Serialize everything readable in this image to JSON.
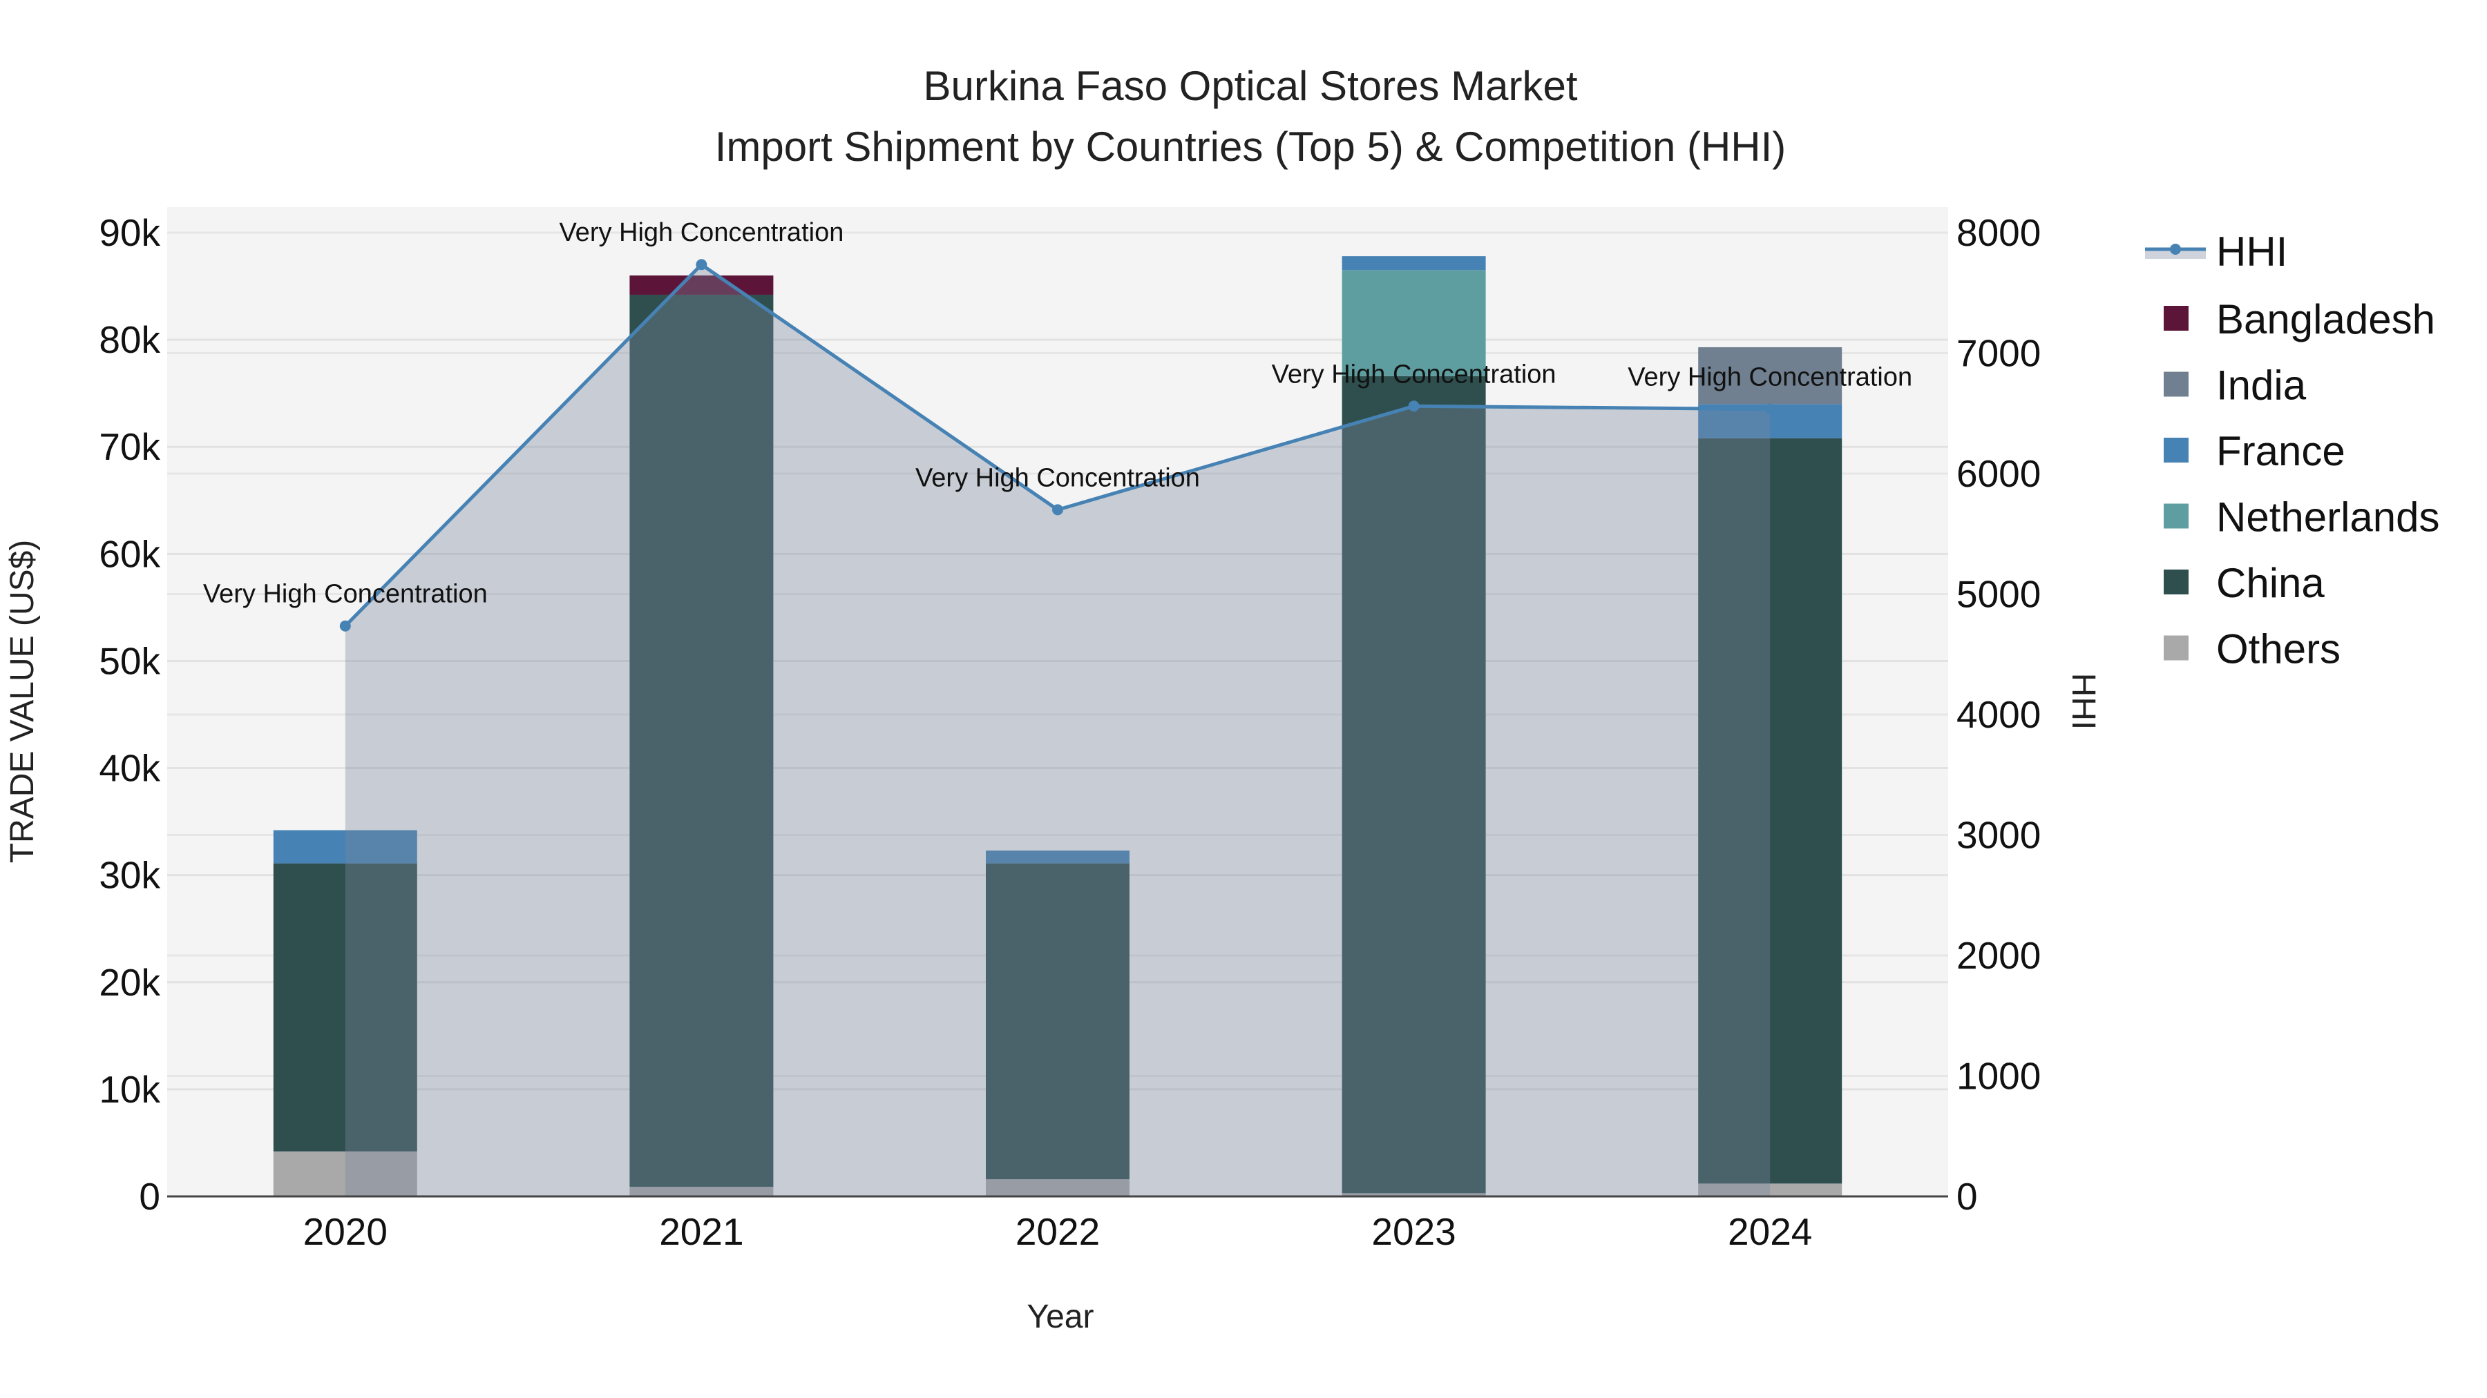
{
  "chart_data": {
    "type": "bar",
    "title": "Burkina Faso Optical Stores Market",
    "subtitle": "Import Shipment by Countries (Top 5) & Competition (HHI)",
    "xlabel": "Year",
    "ylabel": "TRADE VALUE (US$)",
    "y2label": "HHI",
    "categories": [
      "2020",
      "2021",
      "2022",
      "2023",
      "2024"
    ],
    "ylim": [
      0,
      90000
    ],
    "y2lim": [
      0,
      8000
    ],
    "yticks": [
      "0",
      "10k",
      "20k",
      "30k",
      "40k",
      "50k",
      "60k",
      "70k",
      "80k",
      "90k"
    ],
    "y2ticks": [
      "0",
      "1000",
      "2000",
      "3000",
      "4000",
      "5000",
      "6000",
      "7000",
      "8000"
    ],
    "grid": true,
    "legend_position": "right",
    "stack_order": [
      "Others",
      "China",
      "Netherlands",
      "France",
      "India",
      "Bangladesh"
    ],
    "series": [
      {
        "name": "Bangladesh",
        "color": "#5c1538",
        "values": [
          0,
          1800,
          0,
          0,
          0
        ]
      },
      {
        "name": "India",
        "color": "#708090",
        "values": [
          0,
          0,
          0,
          0,
          5300
        ]
      },
      {
        "name": "France",
        "color": "#4682b4",
        "values": [
          3100,
          0,
          1200,
          1300,
          3200
        ]
      },
      {
        "name": "Netherlands",
        "color": "#5f9ea0",
        "values": [
          0,
          0,
          0,
          9900,
          0
        ]
      },
      {
        "name": "China",
        "color": "#2f4f4f",
        "values": [
          26900,
          83300,
          29500,
          76300,
          69600
        ]
      },
      {
        "name": "Others",
        "color": "#a9a9a9",
        "values": [
          4200,
          900,
          1600,
          300,
          1200
        ]
      }
    ],
    "hhi": {
      "name": "HHI",
      "color": "#4682b4",
      "values": [
        4735,
        7735,
        5700,
        6560,
        6535
      ],
      "annotations": [
        "Very High Concentration",
        "Very High Concentration",
        "Very High Concentration",
        "Very High Concentration",
        "Very High Concentration"
      ]
    }
  }
}
